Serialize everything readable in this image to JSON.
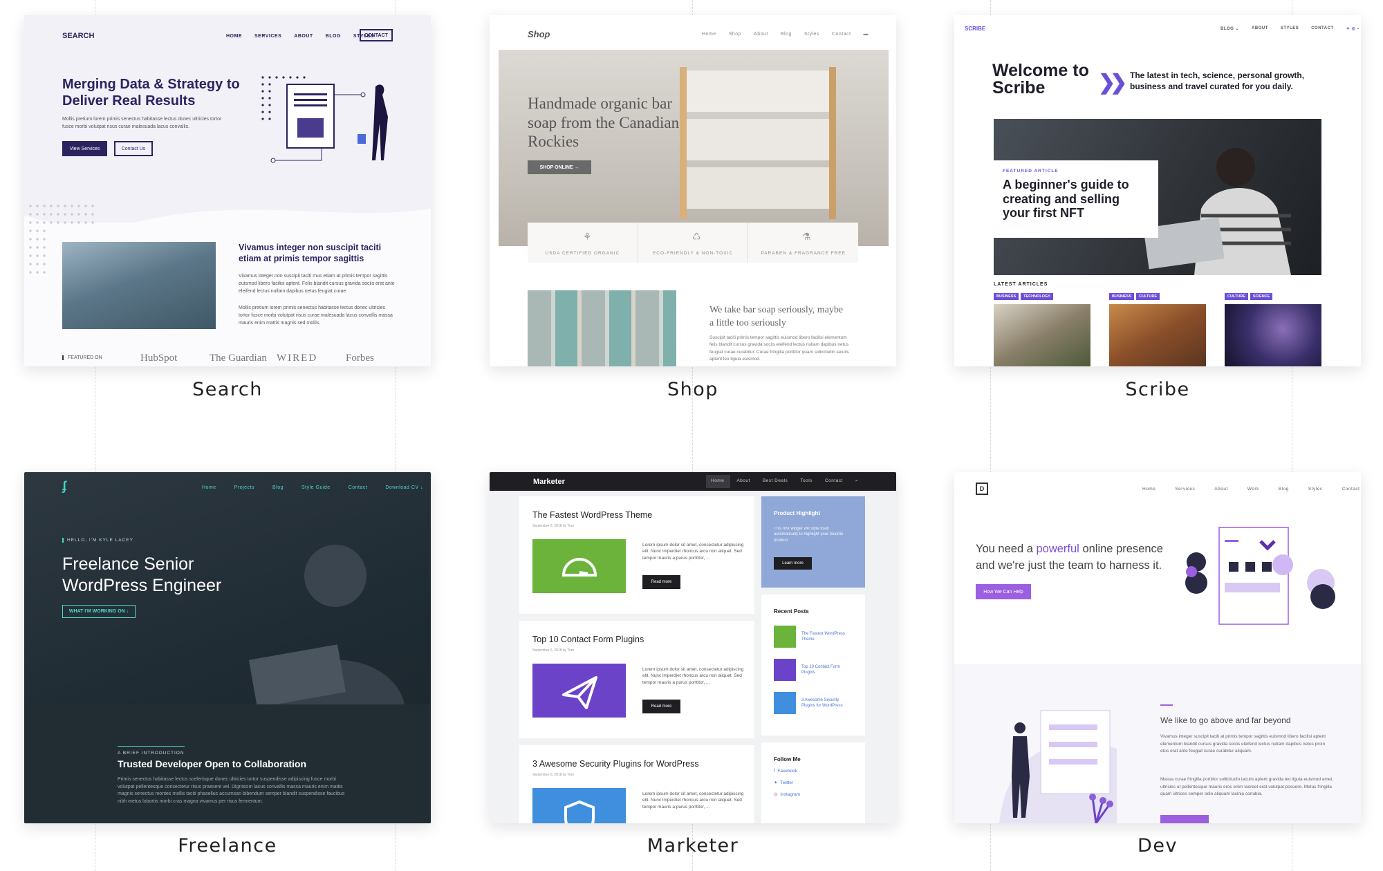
{
  "cards": {
    "search": {
      "label": "Search",
      "logo": "SEARCH",
      "nav": [
        "HOME",
        "SERVICES",
        "ABOUT",
        "BLOG",
        "STYLES"
      ],
      "contact": "CONTACT",
      "hero": "Merging Data & Strategy to Deliver Real Results",
      "sub": "Mollis pretium lorem primis senectus habitasse lectus donec ultricies tortor fusce morbi volutpat risus curae malesuada lacus convallis.",
      "btn_primary": "View Services",
      "btn_secondary": "Contact Us",
      "section_title": "Vivamus integer non suscipit taciti etiam at primis tempor sagittis",
      "section_p1": "Vivamus integer non suscipit taciti mus etiam at primis tempor sagittis euismod libero facilisi aptent. Felis blandit cursus gravida sociis erat ante eleifend lectus nullam dapibus netus feugiat curae.",
      "section_p2": "Mollis pretium lorem primis senectus habitasse lectus donec ultricies tortor fusce morbi volutpat risus curae malesuada lacus convallis massa mauris enim mattis magnis sed mollis.",
      "featured_on": "FEATURED ON",
      "brands": [
        "HubSpot",
        "The Guardian",
        "WIRED",
        "Forbes"
      ]
    },
    "shop": {
      "label": "Shop",
      "logo": "Shop",
      "nav": [
        "Home",
        "Shop",
        "About",
        "Blog",
        "Styles",
        "Contact"
      ],
      "hero": "Handmade organic bar soap from the Canadian Rockies",
      "shop_btn": "SHOP ONLINE →",
      "features": [
        "USDA CERTIFIED ORGANIC",
        "ECO-FRIENDLY & NON-TOXIC",
        "PARABEN & FRAGRANCE FREE"
      ],
      "tagline": "We take bar soap seriously, maybe a little too seriously",
      "tag_p": "Suscipit taciti primis tempor sagittis euismod libero facilisi elementum felis blandit cursus gravida sociis eleifend lectus nullam dapibus netus feugiat curae curabitur. Curae fringilla porttitor quam sollicitudin iaculis aptent leo ligula euismod."
    },
    "scribe": {
      "label": "Scribe",
      "logo": "SCRIBE",
      "nav": [
        "BLOG ⌄",
        "ABOUT",
        "STYLES",
        "CONTACT"
      ],
      "hero": "Welcome to Scribe",
      "arrow": "❯❯",
      "tagline": "The latest in tech, science, personal growth, business and travel curated for you daily.",
      "featured_kicker": "FEATURED ARTICLE",
      "featured_title": "A beginner's guide to creating and selling your first NFT",
      "latest": "LATEST ARTICLES",
      "article_tags": [
        [
          "BUSINESS",
          "TECHNOLOGY"
        ],
        [
          "BUSINESS",
          "CULTURE"
        ],
        [
          "CULTURE",
          "SCIENCE"
        ]
      ]
    },
    "freelance": {
      "label": "Freelance",
      "nav": [
        "Home",
        "Projects",
        "Blog",
        "Style Guide",
        "Contact",
        "Download CV ↓"
      ],
      "hello": "HELLO, I'M KYLE LACEY",
      "hero": "Freelance Senior WordPress Engineer",
      "work_btn": "WHAT I'M WORKING ON ↓",
      "intro": "A BRIEF INTRODUCTION",
      "intro_title": "Trusted Developer Open to Collaboration",
      "intro_p": "Primis senectus habitasse lectus scelerisque donec ultricies tortor suspendisse adipiscing fusce morbi volutpat pellentesque consectetur risus praesent vel. Dignissim lacus convallis massa mauris enim mattis magnis senectus montes mollis taciti phasellus accumsan bibendum semper blandit suspendisse faucibus nibh metus lobortis morbi cras magna vivamus per risus fermentum."
    },
    "marketer": {
      "label": "Marketer",
      "logo": "Marketer",
      "nav": [
        "Home",
        "About",
        "Best Deals",
        "Tools",
        "Contact",
        "⌕"
      ],
      "posts": [
        {
          "title": "The Fastest WordPress Theme",
          "date": "September 6, 2018 by Tom"
        },
        {
          "title": "Top 10 Contact Form Plugins",
          "date": "September 6, 2018 by Tom"
        },
        {
          "title": "3 Awesome Security Plugins for WordPress",
          "date": "September 6, 2018 by Tom"
        }
      ],
      "excerpt": "Lorem ipsum dolor sit amet, consectetur adipiscing elit. Nunc imperdiet rhoncus arcu non aliquet. Sed tempor mauris a purus porttitor, ...",
      "read_more": "Read more",
      "highlight_title": "Product Highlight",
      "highlight_text": "This first widget will style itself automatically to highlight your favorite product.",
      "learn_more": "Learn more",
      "recent_title": "Recent Posts",
      "recent": [
        "The Fastest WordPress Theme",
        "Top 10 Contact Form Plugins",
        "3 Awesome Security Plugins for WordPress"
      ],
      "follow_title": "Follow Me",
      "follow": [
        "Facebook",
        "Twitter",
        "Instagram"
      ],
      "colors": {
        "green": "#6bb33b",
        "purple": "#6a43c9",
        "blue": "#3f8fde"
      }
    },
    "dev": {
      "label": "Dev",
      "logo": "D",
      "nav": [
        "Home",
        "Services",
        "About",
        "Work",
        "Blog",
        "Styles",
        "Contact"
      ],
      "hero_pre": "You need a ",
      "hero_hl": "powerful",
      "hero_post": " online presence and we're just the team to harness it.",
      "help_btn": "How We Can Help",
      "bottom_title": "We like to go above and far beyond",
      "bottom_p1": "Vivamus integer suscipit taciti at primis tempor sagittis euismod libero facilisi aptent elementum blandit cursus gravida sociis eleifend lectus nullam dapibus netus proin etus erat ante feugiat curae curabitur aliquam.",
      "bottom_p2": "Massa curae fringilla porttitor sollicitudin iaculis aptent gravida leo ligula euismod amet, ultricies ut pellentesque mauris eros enim laoreet erat volutpat posuere. Metus fringilla quam ultrices semper odio aliquam lacinia conubia."
    }
  }
}
